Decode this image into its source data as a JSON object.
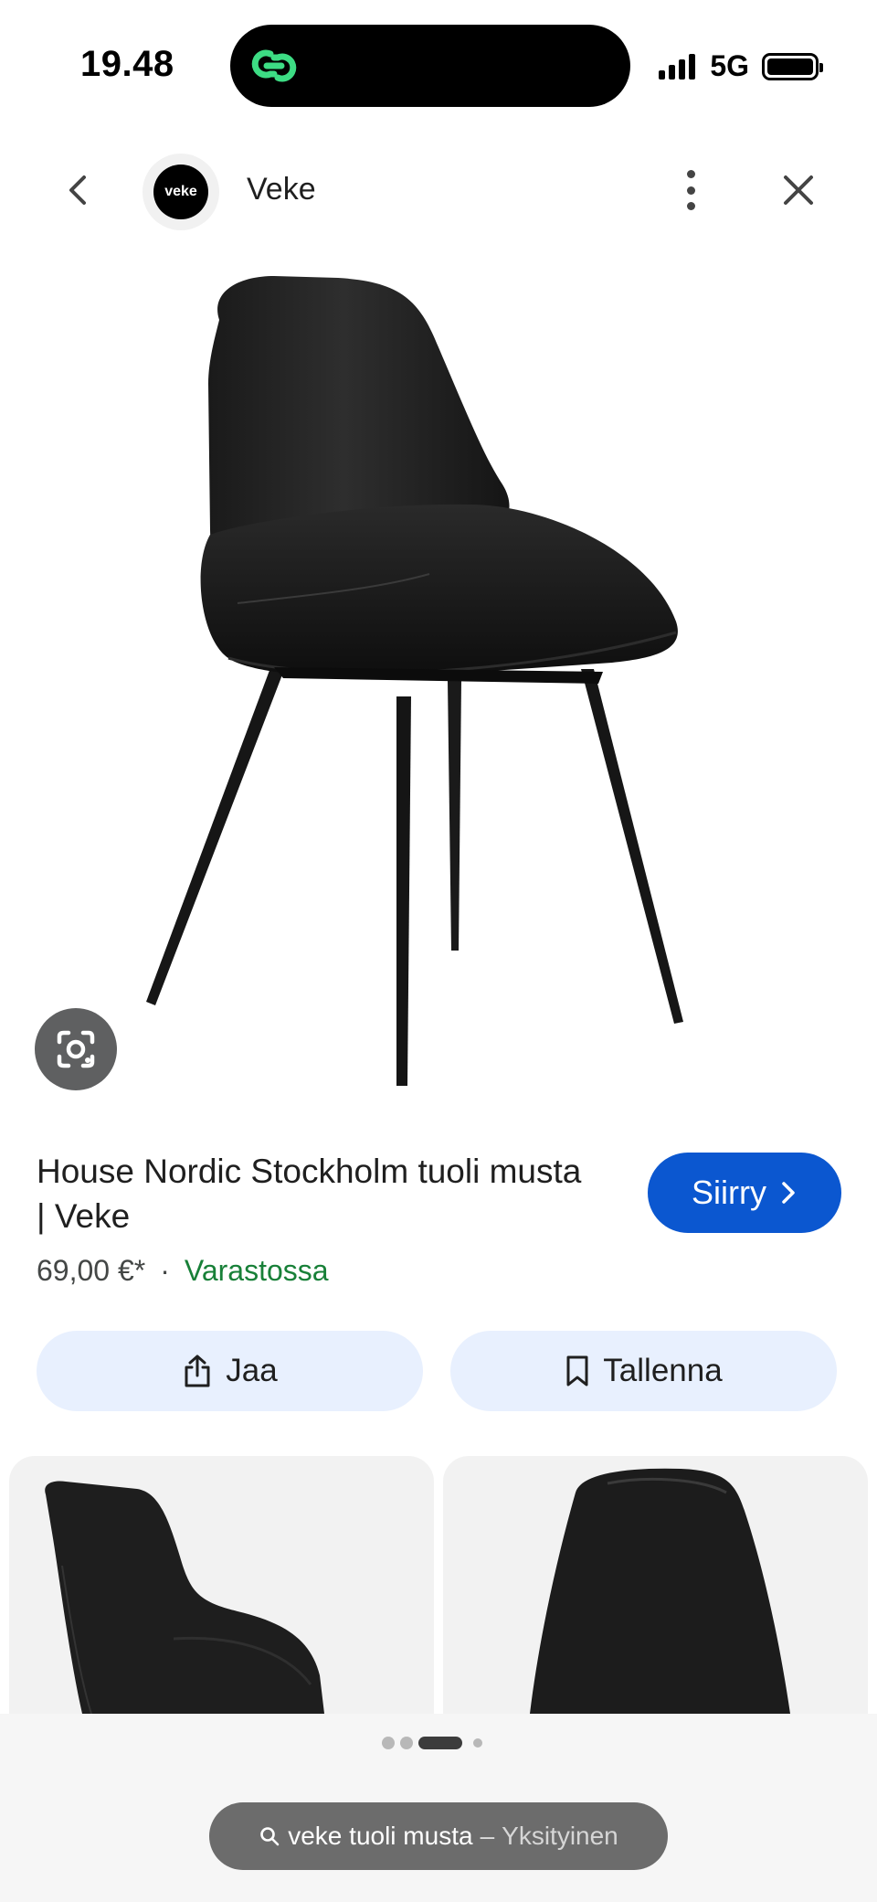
{
  "status_bar": {
    "time": "19.48",
    "network": "5G",
    "signal_bars": 4,
    "battery_level": 0.95
  },
  "header": {
    "site_logo_text": "veke",
    "site_name": "Veke"
  },
  "product": {
    "title": "House Nordic Stockholm tuoli musta | Veke",
    "price": "69,00 €*",
    "separator": "·",
    "stock_status": "Varastossa",
    "go_button_label": "Siirry"
  },
  "actions": {
    "share_label": "Jaa",
    "save_label": "Tallenna"
  },
  "pager": {
    "total": 4,
    "current": 3
  },
  "address_bar": {
    "query": "veke tuoli musta",
    "separator": "–",
    "mode": "Yksityinen"
  },
  "colors": {
    "primary_button": "#0b57d0",
    "action_button_bg": "#e8f0fe",
    "in_stock": "#188038",
    "island_icon": "#3ddc84"
  },
  "icons": {
    "back": "chevron-left-icon",
    "more": "more-vert-icon",
    "close": "close-icon",
    "lens": "google-lens-icon",
    "share": "share-icon",
    "save": "bookmark-icon",
    "search": "search-icon"
  }
}
